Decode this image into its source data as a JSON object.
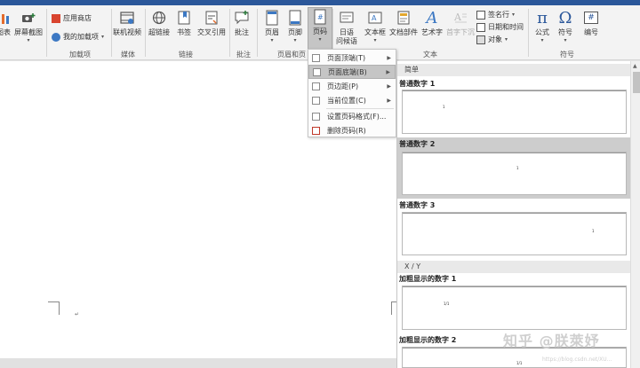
{
  "ribbon": {
    "buttons": {
      "chart": "图表",
      "screenshot": "屏幕截图",
      "app_store": "应用商店",
      "my_addins": "我的加载项",
      "online_video": "联机视频",
      "hyperlink": "超链接",
      "bookmark": "书签",
      "cross_ref": "交叉引用",
      "comment": "批注",
      "header": "页眉",
      "footer": "页脚",
      "page_number": "页码",
      "date_time_line1": "日语",
      "date_time_line2": "问候语",
      "text_box": "文本框",
      "quick_parts": "文档部件",
      "wordart": "艺术字",
      "drop_cap": "首字下沉",
      "signature_line": "签名行",
      "date_time": "日期和时间",
      "object": "对象",
      "equation": "公式",
      "symbol": "符号",
      "numbering": "编号"
    },
    "groups": {
      "addins": "加载项",
      "media": "媒体",
      "links": "链接",
      "comments": "批注",
      "header_footer": "页眉和页",
      "text": "文本",
      "symbols": "符号"
    },
    "icons": {
      "equation_glyph": "π",
      "symbol_glyph": "Ω",
      "numbering_glyph": "#",
      "wordart_glyph": "A",
      "page_number_glyph": "#"
    }
  },
  "menu": {
    "items": [
      {
        "label": "页面顶端(T)",
        "has_sub": true
      },
      {
        "label": "页面底端(B)",
        "has_sub": true
      },
      {
        "label": "页边距(P)",
        "has_sub": true
      },
      {
        "label": "当前位置(C)",
        "has_sub": true
      },
      {
        "label": "设置页码格式(F)...",
        "has_sub": false
      },
      {
        "label": "删除页码(R)",
        "has_sub": false
      }
    ]
  },
  "gallery": {
    "sections": [
      "简单",
      "X / Y"
    ],
    "items": [
      {
        "title": "普通数字 1",
        "num": "1"
      },
      {
        "title": "普通数字 2",
        "num": "1"
      },
      {
        "title": "普通数字 3",
        "num": "1"
      },
      {
        "title": "加粗显示的数字 1",
        "num": "1/1"
      },
      {
        "title": "加粗显示的数字 2",
        "num": "1/1"
      }
    ]
  },
  "watermark": {
    "main": "知乎 @朕萊妤",
    "url": "https://blog.csdn.net/XU..."
  },
  "colors": {
    "accent": "#2b579a",
    "ribbon_bg": "#f3f3f3",
    "highlight": "#c5c5c5"
  }
}
